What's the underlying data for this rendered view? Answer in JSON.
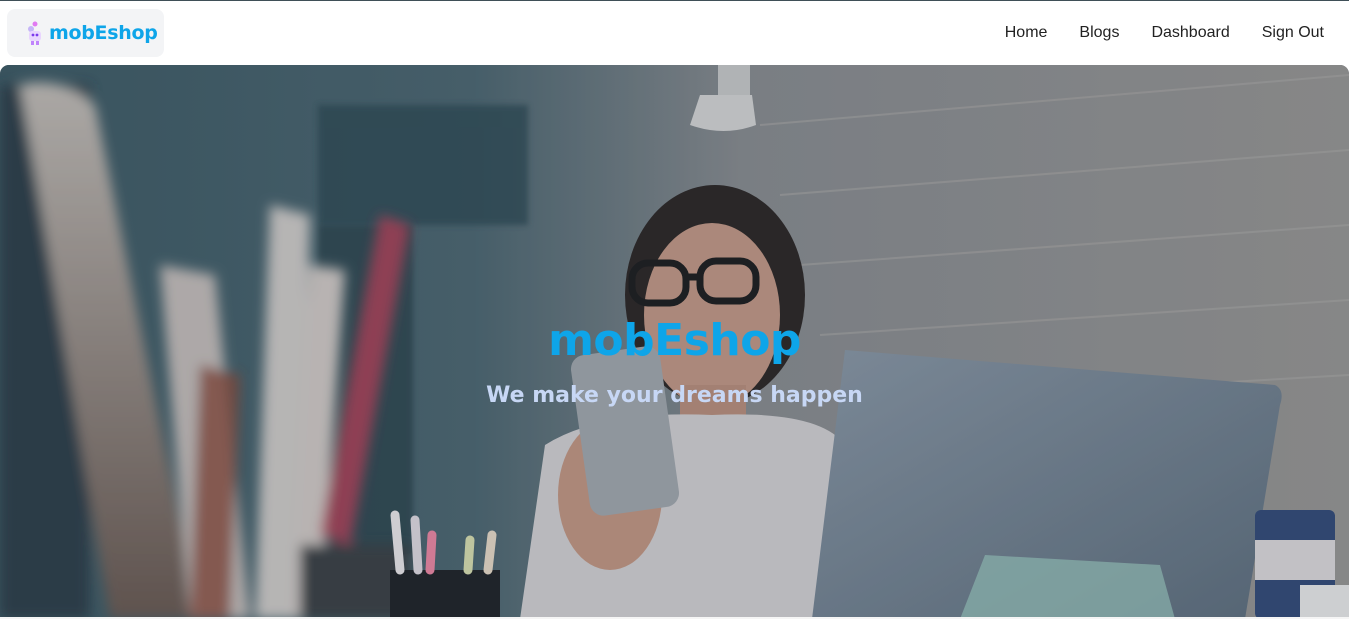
{
  "brand": {
    "name": "mobEshop",
    "logo_icon": "robot-mascot-icon",
    "color": "#0ea5e9"
  },
  "nav": {
    "items": [
      {
        "label": "Home",
        "name": "nav-home"
      },
      {
        "label": "Blogs",
        "name": "nav-blogs"
      },
      {
        "label": "Dashboard",
        "name": "nav-dashboard"
      },
      {
        "label": "Sign Out",
        "name": "nav-sign-out"
      }
    ]
  },
  "hero": {
    "title": "mobEshop",
    "subtitle": "We make your dreams happen",
    "title_color": "#0ea5e9",
    "subtitle_color": "#c7d7f5"
  }
}
